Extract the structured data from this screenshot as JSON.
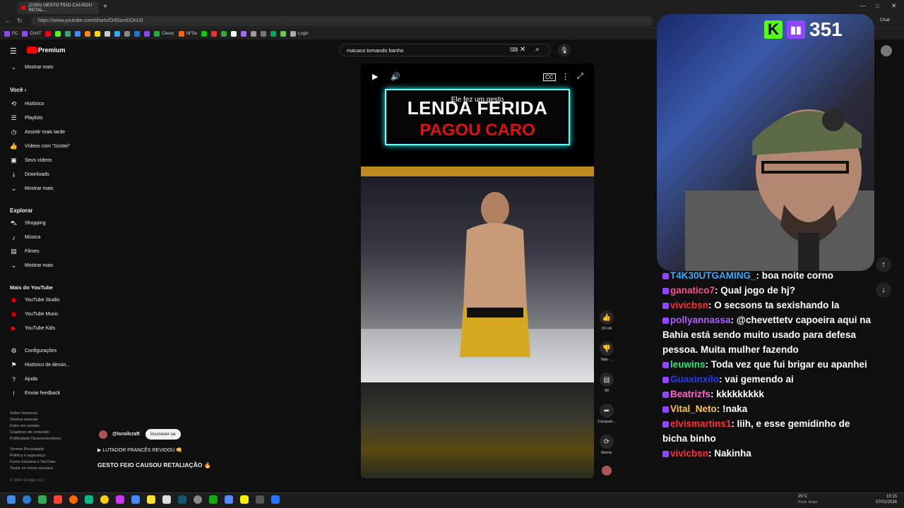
{
  "browser": {
    "tab_title": "(2250) GESTO FEIO CAUSOU RETAL...",
    "url": "https://www.youtube.com/shorts/OrlGomDOnU0",
    "bookmarks": [
      "PC",
      "CHAT",
      "Clever",
      "NFSe",
      "Login"
    ],
    "chat_label": "Chat"
  },
  "youtube": {
    "brand": "Premium",
    "search_value": "macaco tomando banho",
    "sidebar": {
      "show_more_top": "Mostrar mais",
      "you_heading": "Você",
      "you_items": [
        "Histórico",
        "Playlists",
        "Assistir mais tarde",
        "Vídeos com \"Gostei\"",
        "Seus vídeos",
        "Downloads",
        "Mostrar mais"
      ],
      "explore_heading": "Explorar",
      "explore_items": [
        "Shopping",
        "Música",
        "Filmes",
        "Mostrar mais"
      ],
      "more_heading": "Mais do YouTube",
      "more_items": [
        "YouTube Studio",
        "YouTube Music",
        "YouTube Kids"
      ],
      "settings_items": [
        "Configurações",
        "Histórico de denún...",
        "Ajuda",
        "Enviar feedback"
      ],
      "footer1": "Sobre  Imprensa",
      "footer2": "Direitos autorais",
      "footer3": "Entre em contato",
      "footer4": "Criadores de conteúdo",
      "footer5": "Publicidade  Desenvolvedores",
      "footer6": "Termos  Privacidade",
      "footer7": "Política e segurança",
      "footer8": "Como funciona o YouTube",
      "footer9": "Testar os novos recursos",
      "copyright": "© 2026 Google LLC"
    },
    "short": {
      "overlay_line1": "LENDA FERIDA",
      "overlay_line2": "PAGOU CARO",
      "subtitle": "Ele fez um gesto",
      "channel": "@lsroilcraft",
      "subscribe_label": "Inscrever-se",
      "description_line1": "▶ LUTADOR FRANCÊS REVIDOU 👊",
      "description_line2": "GESTO FEIO CAUSOU RETALIAÇÃO 🔥",
      "actions": {
        "likes": "29 mil",
        "dislike": "Não ...",
        "comments": "90",
        "share": "Compart...",
        "remix": "Remix"
      }
    }
  },
  "stream": {
    "viewer_count": "351",
    "kick_letter": "K"
  },
  "chat": [
    {
      "user": "T4K30UTGAMING_",
      "color": "#3fa9f5",
      "text": ": boa noite corno"
    },
    {
      "user": "ganatico7",
      "color": "#ff4f8b",
      "text": ": Qual jogo de hj?"
    },
    {
      "user": "vivicbsn",
      "color": "#ff2e2e",
      "text": ": O secsons ta sexishando la"
    },
    {
      "user": "pollyannassa",
      "color": "#b05cff",
      "text": ": @chevettetv capoeira aqui na Bahia está sendo muito usado para defesa pessoa. Muita mulher fazendo"
    },
    {
      "user": "leuwins",
      "color": "#35e07a",
      "text": ": Toda vez que fui brigar eu apanhei"
    },
    {
      "user": "Guaxinxilo",
      "color": "#1f3fff",
      "text": ": vai gemendo ai"
    },
    {
      "user": "Beatrizfs",
      "color": "#ff66cc",
      "text": ": kkkkkkkkk"
    },
    {
      "user": "Vital_Neto",
      "color": "#ffc83d",
      "text": ": !naka"
    },
    {
      "user": "elvismartins1",
      "color": "#ff3030",
      "text": ": Iiih, e esse gemidinho de bicha binho"
    },
    {
      "user": "vivicbsn",
      "color": "#ff2e2e",
      "text": ": Nakinha"
    }
  ],
  "taskbar": {
    "weather": "25°C",
    "weather_sub": "Pred. limpo",
    "time": "19:15",
    "date": "07/01/2026"
  }
}
